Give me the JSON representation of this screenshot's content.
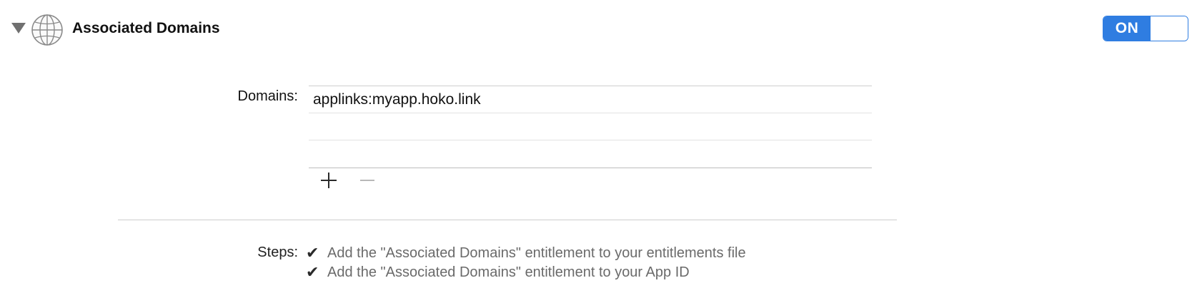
{
  "section": {
    "title": "Associated Domains",
    "icon": "globe-icon",
    "expanded": true
  },
  "toggle": {
    "label": "ON",
    "state": "on",
    "accent_color": "#2f7de1"
  },
  "domains": {
    "label": "Domains:",
    "rows": [
      "applinks:myapp.hoko.link",
      "",
      ""
    ]
  },
  "steps": {
    "label": "Steps:",
    "items": [
      {
        "status": "done",
        "text": "Add the \"Associated Domains\" entitlement to your entitlements file"
      },
      {
        "status": "done",
        "text": "Add the \"Associated Domains\" entitlement to your App ID"
      }
    ]
  }
}
